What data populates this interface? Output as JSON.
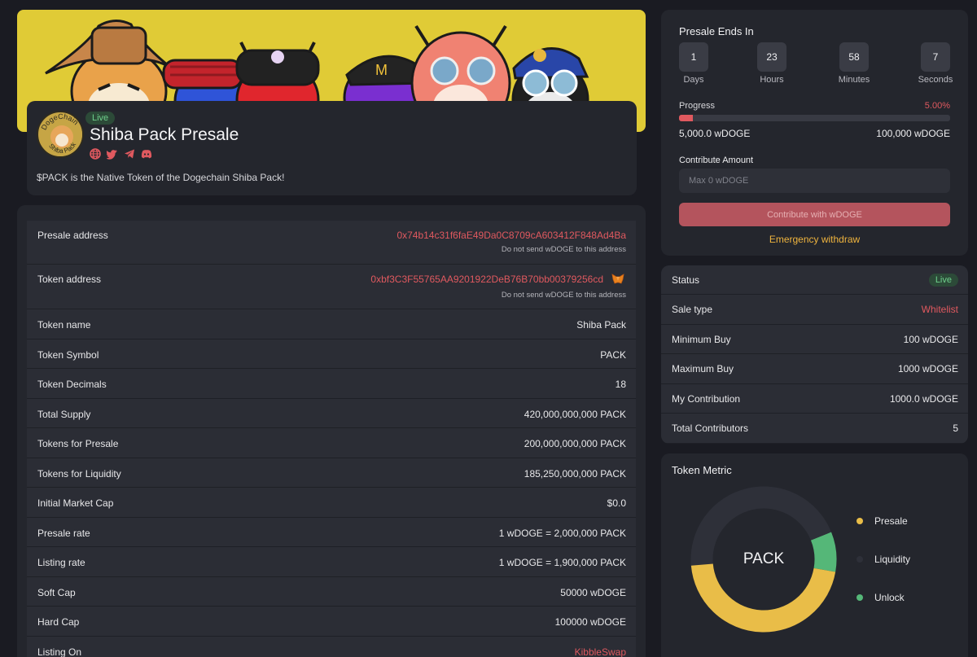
{
  "colors": {
    "accent_red": "#e0595f",
    "live_green": "#6fd08c",
    "warning_yellow": "#efb43e",
    "banner_yellow": "#e0cb36",
    "card_bg": "#24262d",
    "page_bg": "#1a1b22"
  },
  "project": {
    "status_badge": "Live",
    "title": "Shiba Pack Presale",
    "description": "$PACK is the Native Token of the Dogechain Shiba Pack!",
    "logo_text_top": "DogeChain",
    "logo_text_bottom": "Shiba Pack",
    "socials": [
      "globe-icon",
      "twitter-icon",
      "telegram-icon",
      "discord-icon"
    ]
  },
  "details": [
    {
      "label": "Presale address",
      "value": "0x74b14c31f6faE49Da0C8709cA603412F848Ad4Ba",
      "note": "Do not send wDOGE to this address",
      "highlight": true
    },
    {
      "label": "Token address",
      "value": "0xbf3C3F55765AA9201922DeB76B70bb00379256cd",
      "note": "Do not send wDOGE to this address",
      "highlight": true,
      "icon": "metamask-icon"
    },
    {
      "label": "Token name",
      "value": "Shiba Pack"
    },
    {
      "label": "Token Symbol",
      "value": "PACK"
    },
    {
      "label": "Token Decimals",
      "value": "18"
    },
    {
      "label": "Total Supply",
      "value": "420,000,000,000 PACK"
    },
    {
      "label": "Tokens for Presale",
      "value": "200,000,000,000 PACK"
    },
    {
      "label": "Tokens for Liquidity",
      "value": "185,250,000,000 PACK"
    },
    {
      "label": "Initial Market Cap",
      "value": "$0.0"
    },
    {
      "label": "Presale rate",
      "value": "1 wDOGE = 2,000,000 PACK"
    },
    {
      "label": "Listing rate",
      "value": "1 wDOGE = 1,900,000 PACK"
    },
    {
      "label": "Soft Cap",
      "value": "50000 wDOGE"
    },
    {
      "label": "Hard Cap",
      "value": "100000 wDOGE"
    },
    {
      "label": "Listing On",
      "value": "KibbleSwap",
      "highlight": true
    }
  ],
  "presale": {
    "title": "Presale Ends In",
    "countdown": [
      {
        "value": "1",
        "label": "Days"
      },
      {
        "value": "23",
        "label": "Hours"
      },
      {
        "value": "58",
        "label": "Minutes"
      },
      {
        "value": "7",
        "label": "Seconds"
      }
    ],
    "progress_label": "Progress",
    "progress_percent_text": "5.00%",
    "progress_fraction": 0.05,
    "progress_min": "5,000.0 wDOGE",
    "progress_max": "100,000 wDOGE",
    "contribute_label": "Contribute Amount",
    "contribute_placeholder": "Max 0 wDOGE",
    "contribute_button": "Contribute with wDOGE",
    "emergency_link": "Emergency withdraw"
  },
  "status": [
    {
      "label": "Status",
      "value": "Live",
      "pill": true
    },
    {
      "label": "Sale type",
      "value": "Whitelist",
      "highlight": true
    },
    {
      "label": "Minimum Buy",
      "value": "100 wDOGE"
    },
    {
      "label": "Maximum Buy",
      "value": "1000 wDOGE"
    },
    {
      "label": "My Contribution",
      "value": "1000.0 wDOGE"
    },
    {
      "label": "Total Contributors",
      "value": "5"
    }
  ],
  "token_metric": {
    "title": "Token Metric",
    "center_label": "PACK",
    "segments": [
      {
        "name": "Presale",
        "color": "#e9bd48",
        "start_deg": 100,
        "end_deg": 265
      },
      {
        "name": "Liquidity",
        "color": "#2e3039",
        "start_deg": 265,
        "end_deg": 68
      },
      {
        "name": "Unlock",
        "color": "#55b778",
        "start_deg": 68,
        "end_deg": 100
      }
    ]
  }
}
